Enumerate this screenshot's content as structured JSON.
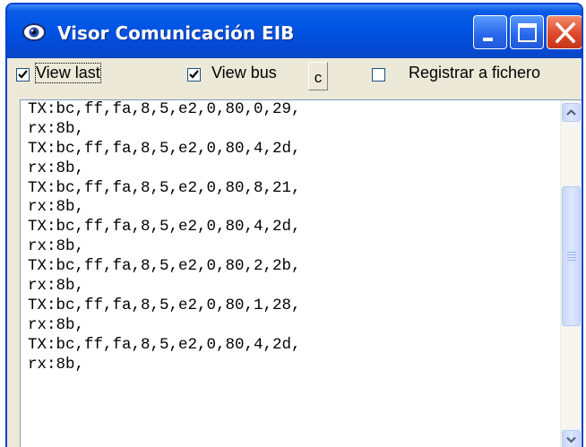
{
  "window": {
    "title": "Visor Comunicación EIB"
  },
  "titlebar": {
    "icon": "eye-icon",
    "buttons": [
      "minimize-icon",
      "maximize-icon",
      "close-icon"
    ]
  },
  "toolbar": {
    "view_last": {
      "label": "View last",
      "checked": true
    },
    "view_bus": {
      "label": "View bus",
      "checked": true
    },
    "c_button_label": "c",
    "registrar": {
      "label": "Registrar a fichero",
      "checked": false
    }
  },
  "log": {
    "lines": [
      "TX:bc,ff,fa,8,5,e2,0,80,0,29,",
      "rx:8b,",
      "TX:bc,ff,fa,8,5,e2,0,80,4,2d,",
      "rx:8b,",
      "TX:bc,ff,fa,8,5,e2,0,80,8,21,",
      "rx:8b,",
      "TX:bc,ff,fa,8,5,e2,0,80,4,2d,",
      "rx:8b,",
      "TX:bc,ff,fa,8,5,e2,0,80,2,2b,",
      "rx:8b,",
      "TX:bc,ff,fa,8,5,e2,0,80,1,28,",
      "rx:8b,",
      "TX:bc,ff,fa,8,5,e2,0,80,4,2d,",
      "rx:8b,"
    ]
  },
  "colors": {
    "titlebar": "#0054e3",
    "close_button": "#de4a2a",
    "window_face": "#ece9d8",
    "scrollbar_thumb": "#c9d9fa"
  }
}
